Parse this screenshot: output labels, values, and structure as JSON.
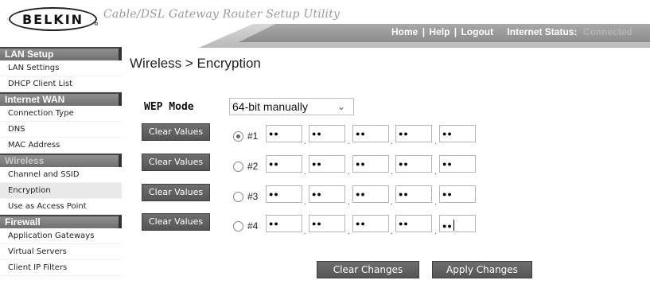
{
  "header": {
    "logo_text": "BELKIN",
    "utility_title": "Cable/DSL Gateway Router Setup Utility",
    "nav": {
      "home": "Home",
      "help": "Help",
      "logout": "Logout",
      "separator": "|",
      "status_label": "Internet Status:",
      "status_value": "Connected"
    }
  },
  "sidebar": {
    "sections": [
      {
        "title": "LAN Setup",
        "items": [
          "LAN Settings",
          "DHCP Client List"
        ]
      },
      {
        "title": "Internet WAN",
        "items": [
          "Connection Type",
          "DNS",
          "MAC Address"
        ]
      },
      {
        "title": "Wireless",
        "items": [
          "Channel and SSID",
          "Encryption",
          "Use as Access Point"
        ]
      },
      {
        "title": "Firewall",
        "items": [
          "Application Gateways",
          "Virtual Servers",
          "Client IP Filters"
        ]
      }
    ],
    "active_item": "Encryption"
  },
  "main": {
    "title": "Wireless > Encryption",
    "wep_mode_label": "WEP Mode",
    "wep_mode_value": "64-bit manually",
    "clear_values_label": "Clear Values",
    "keys": [
      {
        "label": "#1",
        "selected": true,
        "fields": [
          "●●",
          "●●",
          "●●",
          "●●",
          "●●"
        ]
      },
      {
        "label": "#2",
        "selected": false,
        "fields": [
          "●●",
          "●●",
          "●●",
          "●●",
          "●●"
        ]
      },
      {
        "label": "#3",
        "selected": false,
        "fields": [
          "●●",
          "●●",
          "●●",
          "●●",
          "●●"
        ]
      },
      {
        "label": "#4",
        "selected": false,
        "fields": [
          "●●",
          "●●",
          "●●",
          "●●",
          "●●"
        ]
      }
    ],
    "field_separator": ".",
    "clear_changes_label": "Clear Changes",
    "apply_changes_label": "Apply Changes"
  }
}
